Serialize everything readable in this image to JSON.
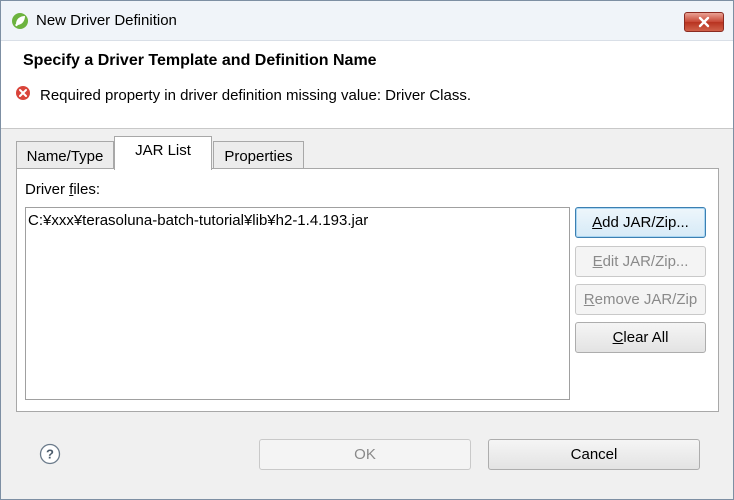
{
  "window": {
    "title": "New Driver Definition"
  },
  "header": {
    "title": "Specify a Driver Template and Definition Name",
    "error_message": "Required property in driver definition missing value: Driver Class."
  },
  "tabs": [
    {
      "label": "Name/Type",
      "active": false
    },
    {
      "label": "JAR List",
      "active": true
    },
    {
      "label": "Properties",
      "active": false
    }
  ],
  "jar_list": {
    "files_label_prefix": "Driver ",
    "files_label_mnemonic": "f",
    "files_label_suffix": "iles:",
    "files": [
      "C:¥xxx¥terasoluna-batch-tutorial¥lib¥h2-1.4.193.jar"
    ],
    "buttons": {
      "add": {
        "mnemonic": "A",
        "rest": "dd JAR/Zip...",
        "enabled": true
      },
      "edit": {
        "mnemonic": "E",
        "rest": "dit JAR/Zip...",
        "enabled": false
      },
      "remove": {
        "mnemonic": "R",
        "rest": "emove JAR/Zip",
        "enabled": false
      },
      "clear": {
        "mnemonic": "C",
        "rest": "lear All",
        "enabled": true
      }
    }
  },
  "footer": {
    "ok_label": "OK",
    "ok_enabled": false,
    "cancel_label": "Cancel"
  },
  "icons": {
    "app": "spring-leaf-icon",
    "close": "close-icon",
    "error": "error-icon",
    "help": "help-icon"
  },
  "colors": {
    "error_red": "#d9443a",
    "app_green": "#6db33f",
    "close_red": "#c74634",
    "default_button_border": "#3c7fb1"
  }
}
